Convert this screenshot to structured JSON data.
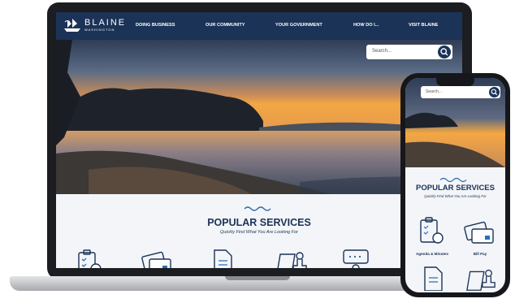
{
  "logo": {
    "name": "BLAINE",
    "subtitle": "WASHINGTON"
  },
  "nav": {
    "items": [
      {
        "label": "DOING BUSINESS"
      },
      {
        "label": "OUR COMMUNITY"
      },
      {
        "label": "YOUR GOVERNMENT"
      },
      {
        "label": "HOW DO I..."
      },
      {
        "label": "VISIT BLAINE"
      }
    ]
  },
  "search": {
    "placeholder": "Search..."
  },
  "popular_services": {
    "title": "POPULAR SERVICES",
    "subtitle": "Quickly Find What You Are Looking For"
  },
  "mobile": {
    "search_placeholder": "Search...",
    "title": "POPULAR SERVICES",
    "subtitle": "Quickly Find What You Are Looking For",
    "services": [
      {
        "label": "Agenda & Minutes",
        "icon": "clipboard-clock-icon"
      },
      {
        "label": "Bill Pay",
        "icon": "credit-card-icon"
      },
      {
        "label": "",
        "icon": "document-icon"
      },
      {
        "label": "",
        "icon": "stamp-icon"
      }
    ]
  },
  "colors": {
    "navy": "#1b3357",
    "accent_blue": "#2a6fb5",
    "sunset": "#f4a742"
  }
}
